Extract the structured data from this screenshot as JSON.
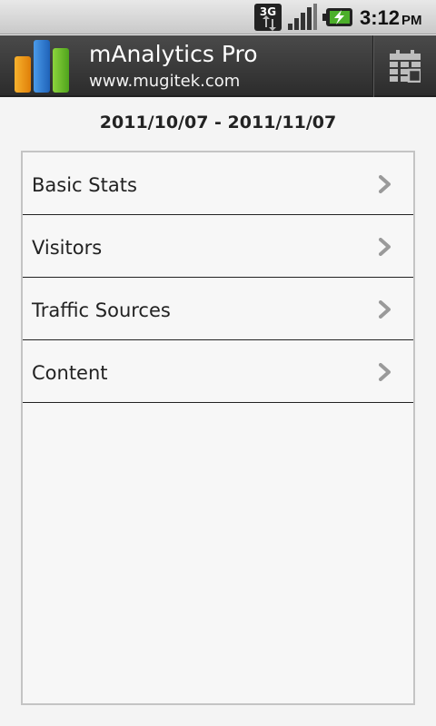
{
  "status_bar": {
    "network_icon": "3g-icon",
    "signal_icon": "signal-icon",
    "battery_icon": "battery-charging-icon",
    "time": "3:12",
    "ampm": "PM"
  },
  "header": {
    "app_title": "mAnalytics Pro",
    "app_subtitle": "www.mugitek.com",
    "logo_icon": "bar-chart-logo-icon",
    "calendar_icon": "calendar-icon"
  },
  "date_range": "2011/10/07 - 2011/11/07",
  "menu": {
    "items": [
      {
        "label": "Basic Stats",
        "icon": "chevron-right-icon"
      },
      {
        "label": "Visitors",
        "icon": "chevron-right-icon"
      },
      {
        "label": "Traffic Sources",
        "icon": "chevron-right-icon"
      },
      {
        "label": "Content",
        "icon": "chevron-right-icon"
      }
    ]
  },
  "colors": {
    "title_bar": "#3a3a3a",
    "background": "#f4f4f4",
    "logo_orange": "#f29a12",
    "logo_blue": "#2f7fd6",
    "logo_green": "#6fc12a"
  }
}
